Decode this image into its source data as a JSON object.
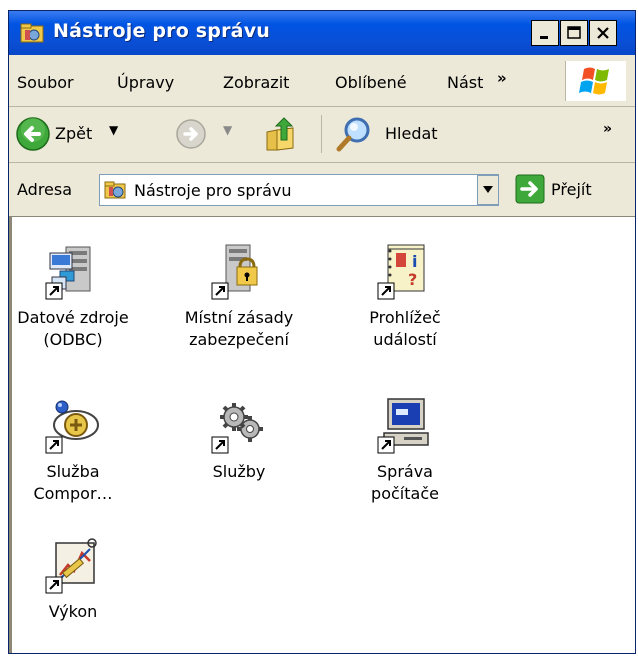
{
  "window": {
    "title": "Nástroje pro správu",
    "controls": {
      "minimize": "_",
      "maximize": "□",
      "close": "X"
    }
  },
  "menubar": {
    "items": [
      "Soubor",
      "Úpravy",
      "Zobrazit",
      "Oblíbené",
      "Nást"
    ],
    "overflow": "»"
  },
  "toolbar": {
    "back_label": "Zpět",
    "search_label": "Hledat",
    "overflow": "»"
  },
  "address": {
    "label": "Adresa",
    "value": "Nástroje pro správu",
    "go_label": "Přejít"
  },
  "items": [
    {
      "label_line1": "Datové zdroje",
      "label_line2": "(ODBC)",
      "icon": "odbc-datasources-icon"
    },
    {
      "label_line1": "Místní zásady",
      "label_line2": "zabezpečení",
      "icon": "local-security-policy-icon"
    },
    {
      "label_line1": "Prohlížeč",
      "label_line2": "událostí",
      "icon": "event-viewer-icon"
    },
    {
      "label_line1": "Služba",
      "label_line2": "Compor…",
      "icon": "component-services-icon"
    },
    {
      "label_line1": "Služby",
      "label_line2": "",
      "icon": "services-icon"
    },
    {
      "label_line1": "Správa",
      "label_line2": "počítače",
      "icon": "computer-management-icon"
    },
    {
      "label_line1": "Výkon",
      "label_line2": "",
      "icon": "performance-icon"
    }
  ],
  "colors": {
    "title_bar": "#0054e3",
    "chrome": "#ece9d8",
    "content_bg": "#ffffff"
  }
}
